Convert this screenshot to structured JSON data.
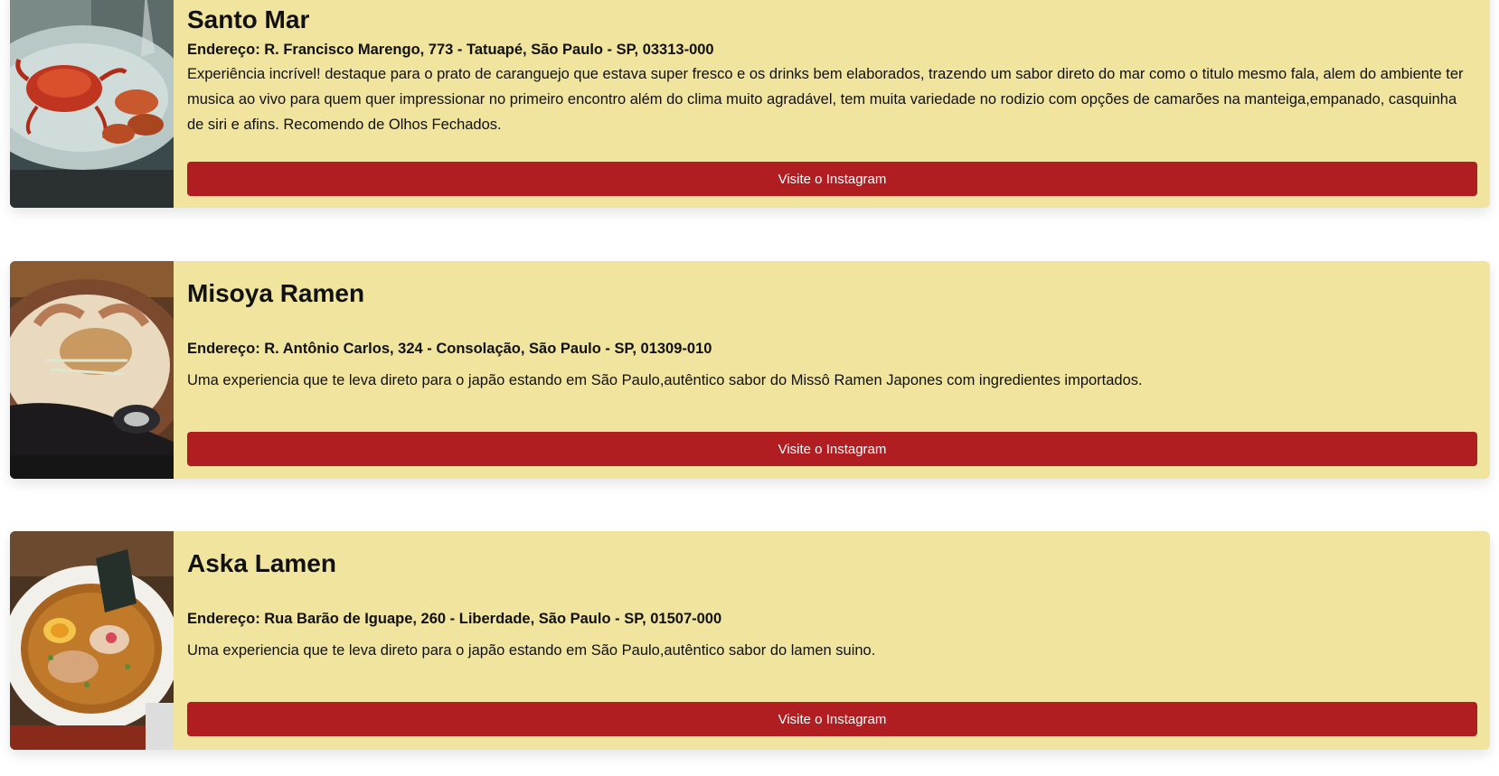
{
  "restaurants": [
    {
      "name": "Santo Mar",
      "address": "Endereço: R. Francisco Marengo, 773 - Tatuapé, São Paulo - SP, 03313-000",
      "description": "Experiência incrível! destaque para o prato de caranguejo que estava super fresco e os drinks bem elaborados, trazendo um sabor direto do mar como o titulo mesmo fala, alem do ambiente ter musica ao vivo para quem quer impressionar no primeiro encontro além do clima muito agradável, tem muita variedade no rodizio com opções de camarões na manteiga,empanado, casquinha de siri e afins. Recomendo de Olhos Fechados.",
      "button_label": "Visite o Instagram"
    },
    {
      "name": "Misoya Ramen",
      "address": "Endereço: R. Antônio Carlos, 324 - Consolação, São Paulo - SP, 01309-010",
      "description": "Uma experiencia que te leva direto para o japão estando em São Paulo,autêntico sabor do Missô Ramen Japones com ingredientes importados.",
      "button_label": "Visite o Instagram"
    },
    {
      "name": "Aska Lamen",
      "address": "Endereço: Rua Barão de Iguape, 260 - Liberdade, São Paulo - SP, 01507-000",
      "description": "Uma experiencia que te leva direto para o japão estando em São Paulo,autêntico sabor do lamen suino.",
      "button_label": "Visite o Instagram"
    }
  ],
  "colors": {
    "card_background": "#f0e49e",
    "button_background": "#b01e22",
    "button_text": "#ffffff"
  }
}
